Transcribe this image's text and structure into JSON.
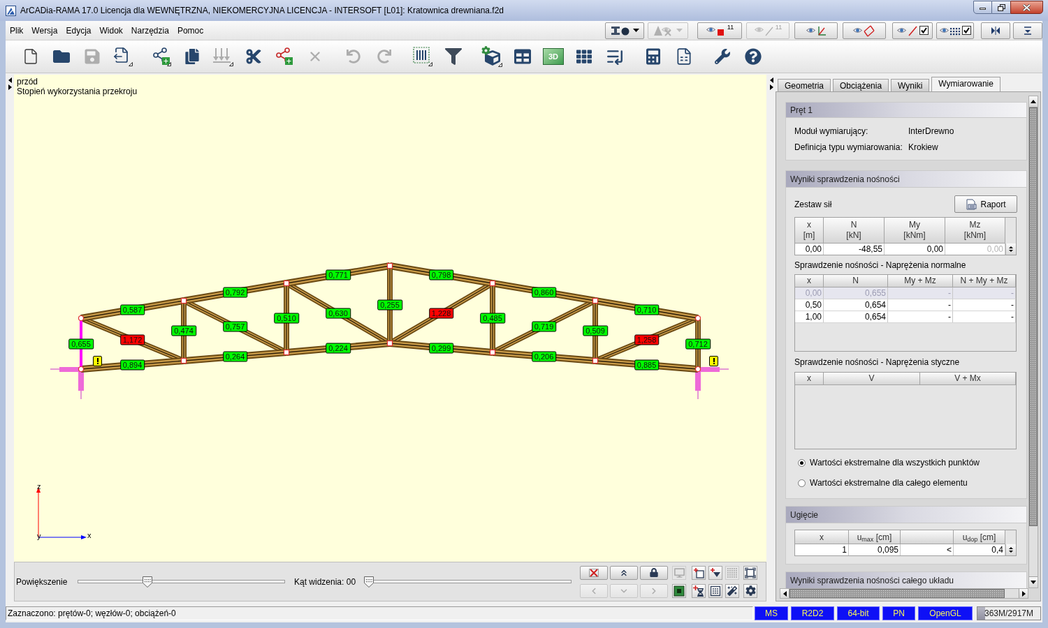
{
  "window": {
    "title": "ArCADia-RAMA 17.0 Licencja dla WEWNĘTRZNA, NIEKOMERCYJNA LICENCJA - INTERSOFT [L01]: Kratownica drewniana.f2d"
  },
  "menu": [
    "Plik",
    "Wersja",
    "Edycja",
    "Widok",
    "Narzędzia",
    "Pomoc"
  ],
  "view_toggles": [
    {
      "kind": "dropdown",
      "disabled": false
    },
    {
      "kind": "dropdown",
      "disabled": true
    },
    {
      "kind": "toggle",
      "label": "11",
      "disabled": false
    },
    {
      "kind": "toggle",
      "label": "11",
      "disabled": true
    },
    {
      "kind": "toggle",
      "disabled": false
    },
    {
      "kind": "toggle",
      "disabled": false
    },
    {
      "kind": "check",
      "checked": true,
      "disabled": false
    },
    {
      "kind": "check",
      "checked": true,
      "disabled": false
    },
    {
      "kind": "toggle",
      "disabled": false
    },
    {
      "kind": "toggle",
      "disabled": false
    }
  ],
  "toolbar": {
    "groups": [
      {
        "buttons": [
          {
            "disabled": false
          },
          {
            "disabled": false
          },
          {
            "disabled": true
          },
          {
            "disabled": false
          }
        ]
      },
      {
        "buttons": [
          {
            "disabled": false
          },
          {
            "disabled": false
          },
          {
            "disabled": true
          },
          {
            "disabled": false
          },
          {
            "disabled": false
          },
          {
            "disabled": true
          }
        ]
      },
      {
        "buttons": [
          {
            "disabled": true
          },
          {
            "disabled": true
          }
        ]
      },
      {
        "buttons": [
          {
            "disabled": false
          },
          {
            "disabled": false
          }
        ]
      },
      {
        "buttons": [
          {
            "disabled": false
          },
          {
            "disabled": false
          },
          {
            "disabled": false,
            "label": "3D"
          },
          {
            "disabled": false
          },
          {
            "disabled": false
          }
        ]
      },
      {
        "buttons": [
          {
            "disabled": false
          },
          {
            "disabled": false
          }
        ]
      },
      {
        "buttons": [
          {
            "disabled": false
          },
          {
            "disabled": false
          }
        ]
      }
    ]
  },
  "viewport": {
    "view_name": "przód",
    "mode": "Stopień wykorzystania przekroju",
    "top_chord": [
      {
        "value": "0,587",
        "color": "#00ff00",
        "selected": false
      },
      {
        "value": "0,792",
        "color": "#00ff00",
        "selected": false
      },
      {
        "value": "0,771",
        "color": "#00ff00",
        "selected": false
      },
      {
        "value": "0,798",
        "color": "#00ff00",
        "selected": false
      },
      {
        "value": "0,860",
        "color": "#00ff00",
        "selected": false
      },
      {
        "value": "0,710",
        "color": "#00ff00",
        "selected": false
      }
    ],
    "bottom_chord": [
      {
        "value": "0,894",
        "color": "#00ff00",
        "selected": false
      },
      {
        "value": "0,264",
        "color": "#00ff00",
        "selected": false
      },
      {
        "value": "0,224",
        "color": "#00ff00",
        "selected": false
      },
      {
        "value": "0,299",
        "color": "#00ff00",
        "selected": false
      },
      {
        "value": "0,206",
        "color": "#00ff00",
        "selected": false
      },
      {
        "value": "0,885",
        "color": "#00ff00",
        "selected": false
      }
    ],
    "verticals": [
      {
        "value": "0,655",
        "color": "#00ff00",
        "selected": true
      },
      {
        "value": "0,474",
        "color": "#00ff00",
        "selected": false
      },
      {
        "value": "0,510",
        "color": "#00ff00",
        "selected": false
      },
      {
        "value": "0,255",
        "color": "#00ff00",
        "selected": false
      },
      {
        "value": "0,485",
        "color": "#00ff00",
        "selected": false
      },
      {
        "value": "0,509",
        "color": "#00ff00",
        "selected": false
      },
      {
        "value": "0,712",
        "color": "#00ff00",
        "selected": false
      }
    ],
    "diagonals": [
      {
        "value": "1,172",
        "color": "#ff0000",
        "selected": false
      },
      {
        "value": "0,757",
        "color": "#00ff00",
        "selected": false
      },
      {
        "value": "0,630",
        "color": "#00ff00",
        "selected": false
      },
      {
        "value": "1,228",
        "color": "#ff0000",
        "selected": false
      },
      {
        "value": "0,719",
        "color": "#00ff00",
        "selected": false
      },
      {
        "value": "1,258",
        "color": "#ff0000",
        "selected": false
      }
    ],
    "axes": {
      "z": "z",
      "x": "x",
      "y": "y"
    }
  },
  "view_controls": {
    "zoom": {
      "label": "Powiększenie",
      "level": 0.33
    },
    "angle": {
      "label": "Kąt widzenia: 00",
      "level": 0
    },
    "navigation_buttons": [
      {
        "disabled": false
      },
      {
        "disabled": false
      },
      {
        "disabled": false
      },
      {
        "disabled": true
      },
      {
        "disabled": true
      },
      {
        "disabled": true
      }
    ],
    "tool_buttons": [
      {
        "disabled": true
      },
      {
        "disabled": false
      },
      {
        "disabled": false
      },
      {
        "disabled": true
      },
      {
        "disabled": false
      },
      {
        "disabled": false
      },
      {
        "disabled": false
      },
      {
        "disabled": false
      },
      {
        "disabled": false
      },
      {
        "disabled": false
      }
    ]
  },
  "tabs": [
    {
      "label": "Geometria",
      "selected": false
    },
    {
      "label": "Obciążenia",
      "selected": false
    },
    {
      "label": "Wyniki",
      "selected": false
    },
    {
      "label": "Wymiarowanie",
      "selected": true
    }
  ],
  "member_section": {
    "title": "Pręt 1",
    "fields": [
      {
        "label": "Moduł wymiarujący:",
        "value": "InterDrewno"
      },
      {
        "label": "Definicja typu wymiarowania:",
        "value": "Krokiew"
      }
    ]
  },
  "capacity_section": {
    "title": "Wyniki sprawdzenia nośności",
    "forces": {
      "label": "Zestaw sił",
      "report_button": "Raport",
      "columns": [
        {
          "name": "x",
          "unit": "[m]"
        },
        {
          "name": "N",
          "unit": "[kN]"
        },
        {
          "name": "My",
          "unit": "[kNm]"
        },
        {
          "name": "Mz",
          "unit": "[kNm]"
        }
      ],
      "rows": [
        {
          "cells": [
            {
              "text": "0,00",
              "dimmed": false
            },
            {
              "text": "-48,55",
              "dimmed": false
            },
            {
              "text": "0,00",
              "dimmed": false
            },
            {
              "text": "0,00",
              "dimmed": true
            }
          ]
        }
      ]
    },
    "normal_stress": {
      "title": "Sprawdzenie nośności - Naprężenia normalne",
      "columns": [
        "x",
        "N",
        "My + Mz",
        "N + My + Mz"
      ],
      "rows": [
        {
          "cells": [
            "0,00",
            "0,655",
            "-",
            "-"
          ],
          "selected": true
        },
        {
          "cells": [
            "0,50",
            "0,654",
            "-",
            "-"
          ],
          "selected": false
        },
        {
          "cells": [
            "1,00",
            "0,654",
            "-",
            "-"
          ],
          "selected": false
        }
      ]
    },
    "shear_stress": {
      "title": "Sprawdzenie nośności - Naprężenia styczne",
      "columns": [
        "x",
        "V",
        "V + Mx"
      ]
    },
    "extremes": [
      {
        "label": "Wartości ekstremalne dla wszystkich punktów",
        "selected": true
      },
      {
        "label": "Wartości ekstremalne dla całego elementu",
        "selected": false
      }
    ]
  },
  "deflection_section": {
    "title": "Ugięcie",
    "columns": [
      {
        "kind": "text",
        "label": "x"
      },
      {
        "kind": "text",
        "label": "u$_{max}$ [cm]"
      },
      {
        "kind": "blank"
      },
      {
        "kind": "text",
        "label": "u$_{dop}$ [cm]"
      }
    ],
    "rows": [
      {
        "cells": [
          "1",
          "0,095",
          "<",
          "0,4"
        ]
      }
    ]
  },
  "system_section": {
    "title": "Wyniki sprawdzenia nośności całego układu"
  },
  "status_bar": {
    "text": "Zaznaczono: prętów-0; węzłów-0; obciążeń-0",
    "indicators": [
      "MS",
      "R2D2",
      "64-bit",
      "PN",
      "OpenGL"
    ],
    "memory": {
      "text": "363M/2917M",
      "level": 0.12
    }
  }
}
